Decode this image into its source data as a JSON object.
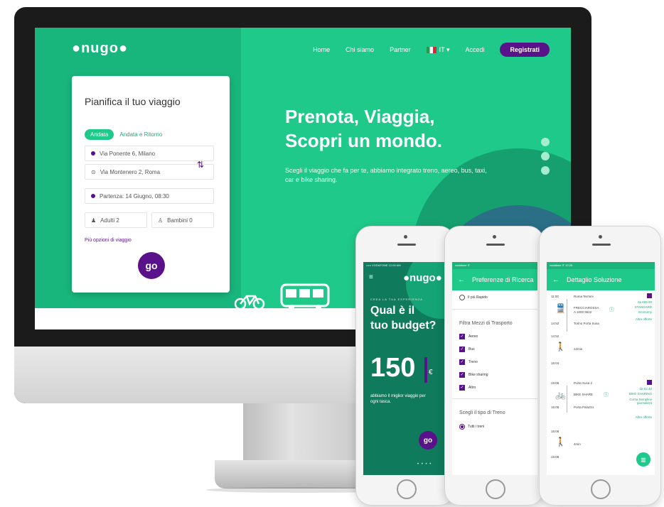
{
  "desktop": {
    "logo": "●nugo●",
    "nav": {
      "home": "Home",
      "about": "Chi siamo",
      "partner": "Partner",
      "language": "IT ▾",
      "login": "Accedi",
      "register": "Registrati"
    },
    "planner": {
      "title": "Pianifica il tuo viaggio",
      "tab_active": "Andata",
      "tab_inactive": "Andata e Ritorno",
      "from": "Via Ponente 6, Milano",
      "to": "Via Montenero 2, Roma",
      "date": "Partenza: 14 Giugno, 08:30",
      "adults": "Adulti  2",
      "children": "Bambini  0",
      "more_options": "Più opzioni di viaggio",
      "go_label": "go"
    },
    "hero": {
      "headline_line1": "Prenota, Viaggia,",
      "headline_line2": "Scopri un mondo.",
      "subtitle": "Scegli il viaggio che fa per te, abbiamo integrato treno, aereo, bus, taxi, car e bike sharing."
    }
  },
  "phone_budget": {
    "status": "••••• VODAFONE   12:00 AM",
    "menu_icon": "≡",
    "logo": "●nugo●",
    "kicker": "CREA LA TUA ESPERIENZA",
    "question_line1": "Qual è il",
    "question_line2": "tuo budget?",
    "amount": "150",
    "currency": "€",
    "tagline": "abbiamo il miglior viaggio per ogni tasca.",
    "go_label": "go",
    "pager": "• • • •"
  },
  "phone_preferences": {
    "status": "vodafone IT",
    "title": "Preferenze di Ricerca",
    "fastest": "Il più Rapido",
    "filter_title": "Filtra Mezzi di Trasporto",
    "modes": [
      "Aereo",
      "Bus",
      "Treno",
      "Bike sharing",
      "Altro"
    ],
    "train_title": "Scegli il tipo di Treno",
    "train_option": "Tutti i treni"
  },
  "phone_detail": {
    "status": "vodafone IT   10:25",
    "title": "Dettaglio Soluzione",
    "t1_time": "11:00",
    "t1_place": "Roma Termini",
    "t1_service": "FRECCIAROSSA",
    "t1_code": "A 1000 9622",
    "t1_price": "da €69.90",
    "t1_class": "STANDARD",
    "t1_fare": "Economy",
    "t1_more": "Altre offerte",
    "t1_arrival_time": "14:52",
    "t1_arrival": "Torino Porta Susa",
    "w1_time_start": "14:52",
    "w1_duration": "12min",
    "w1_time_end": "15:04",
    "b1_time": "15:05",
    "b1_place": "Porta Susa 2",
    "b1_service": "BIKE SHARE",
    "b1_price": "da €2.40",
    "b1_type": "BIKE SHARING",
    "b1_note": "Corsa Semplice giornaliera",
    "b1_more": "Altre offerte",
    "b1_arrival_time": "15:05",
    "b1_arrival": "Porta Palazzo",
    "w2_time_start": "15:06",
    "w2_duration": "4min",
    "w2_time_end": "15:08"
  },
  "colors": {
    "brand_green": "#1fc98a",
    "brand_purple": "#5a128a",
    "accent_red": "#e23a57"
  }
}
